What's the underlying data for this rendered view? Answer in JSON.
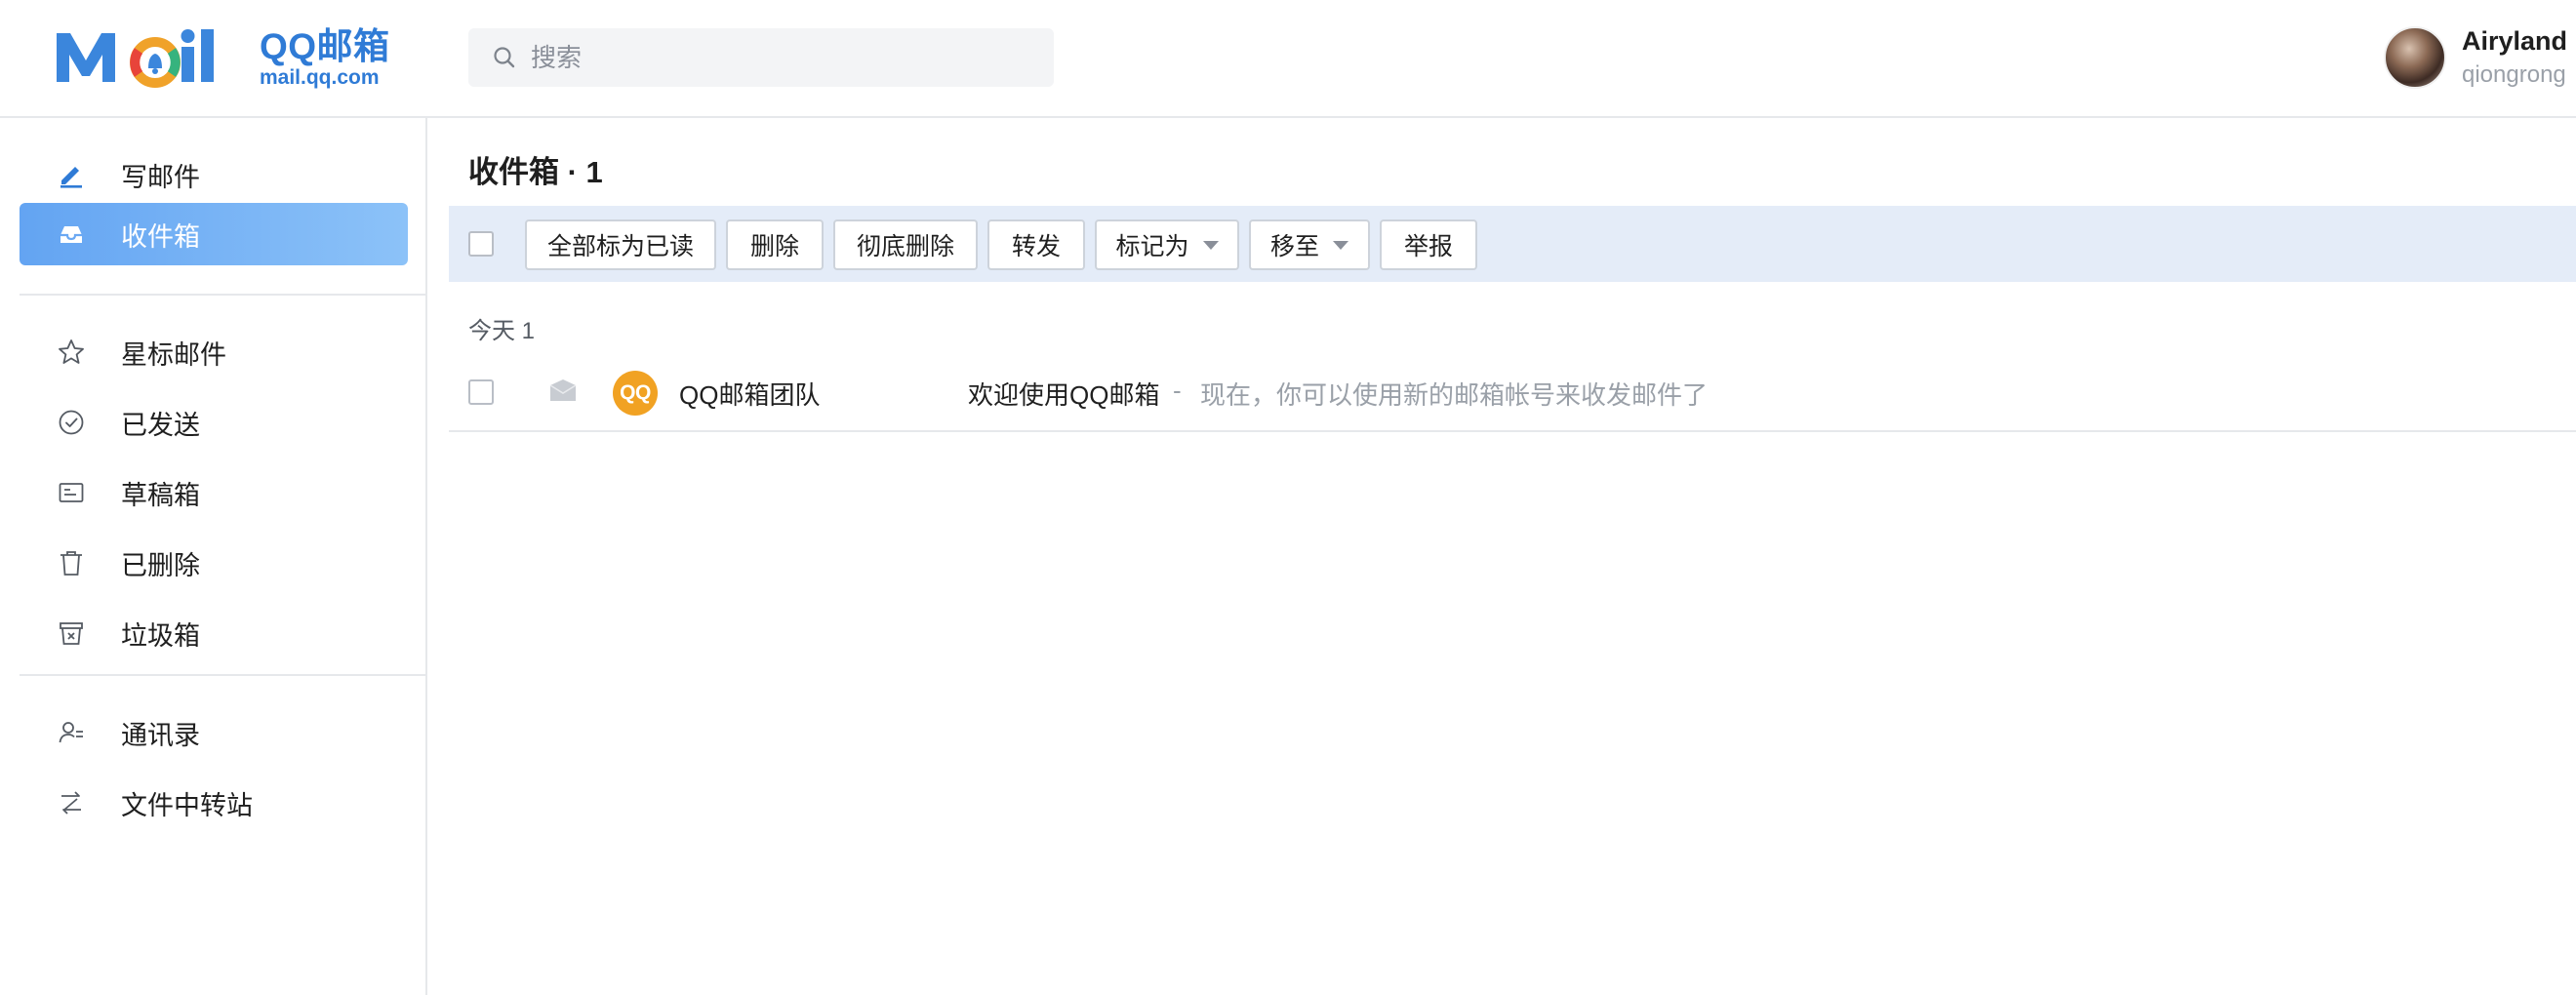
{
  "header": {
    "logo_title": "QQ邮箱",
    "logo_sub": "mail.qq.com",
    "search_placeholder": "搜索",
    "user_name": "Airyland",
    "user_email": "qiongrong",
    "avatar_icon": "user-avatar-photo"
  },
  "sidebar": {
    "compose": {
      "label": "写邮件",
      "icon": "pencil-icon"
    },
    "items": [
      {
        "label": "收件箱",
        "icon": "inbox-icon",
        "active": true
      },
      {
        "label": "星标邮件",
        "icon": "star-icon"
      },
      {
        "label": "已发送",
        "icon": "check-circle-icon"
      },
      {
        "label": "草稿箱",
        "icon": "draft-icon"
      },
      {
        "label": "已删除",
        "icon": "trash-icon"
      },
      {
        "label": "垃圾箱",
        "icon": "spam-icon"
      },
      {
        "label": "通讯录",
        "icon": "contacts-icon"
      },
      {
        "label": "文件中转站",
        "icon": "file-transfer-icon"
      }
    ]
  },
  "main": {
    "folder_title": "收件箱 · 1",
    "toolbar": {
      "mark_all_read": "全部标为已读",
      "delete": "删除",
      "delete_permanently": "彻底删除",
      "forward": "转发",
      "mark_as": "标记为",
      "move_to": "移至",
      "report": "举报"
    },
    "group_label": "今天 1",
    "mails": [
      {
        "avatar_text": "QQ",
        "sender": "QQ邮箱团队",
        "subject": "欢迎使用QQ邮箱",
        "separator": "-",
        "preview": "现在，你可以使用新的邮箱帐号来收发邮件了"
      }
    ]
  },
  "colors": {
    "brand": "#2f7bd6",
    "active_nav": "#63a4f2",
    "toolbar_bg": "#e4ecf8",
    "sender_avatar": "#f1a223"
  }
}
